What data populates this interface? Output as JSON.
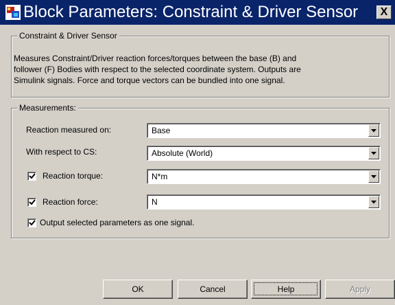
{
  "window": {
    "title": "Block Parameters: Constraint & Driver  Sensor",
    "close_label": "X"
  },
  "description_group": {
    "legend": "Constraint & Driver Sensor",
    "lines": [
      "Measures Constraint/Driver reaction forces/torques between the base (B) and",
      "follower (F) Bodies with respect to the selected coordinate system. Outputs are",
      "Simulink signals. Force and torque vectors can be bundled into one signal."
    ]
  },
  "measurements": {
    "legend": "Measurements:",
    "reaction_measured_on": {
      "label": "Reaction measured on:",
      "value": "Base"
    },
    "with_respect_to": {
      "label": "With respect to CS:",
      "value": "Absolute (World)"
    },
    "reaction_torque": {
      "label": "Reaction torque:",
      "checked": true,
      "value": "N*m"
    },
    "reaction_force": {
      "label": "Reaction force:",
      "checked": true,
      "value": "N"
    },
    "one_signal": {
      "label": "Output selected parameters as one signal.",
      "checked": true
    }
  },
  "buttons": {
    "ok": "OK",
    "cancel": "Cancel",
    "help": "Help",
    "apply": "Apply"
  },
  "icons": {
    "app": "simulink-block-icon",
    "close": "close-icon",
    "dropdown": "chevron-down-icon",
    "check": "checkmark-icon"
  },
  "colors": {
    "titlebar": "#0a246a",
    "face": "#d4d0c8"
  }
}
